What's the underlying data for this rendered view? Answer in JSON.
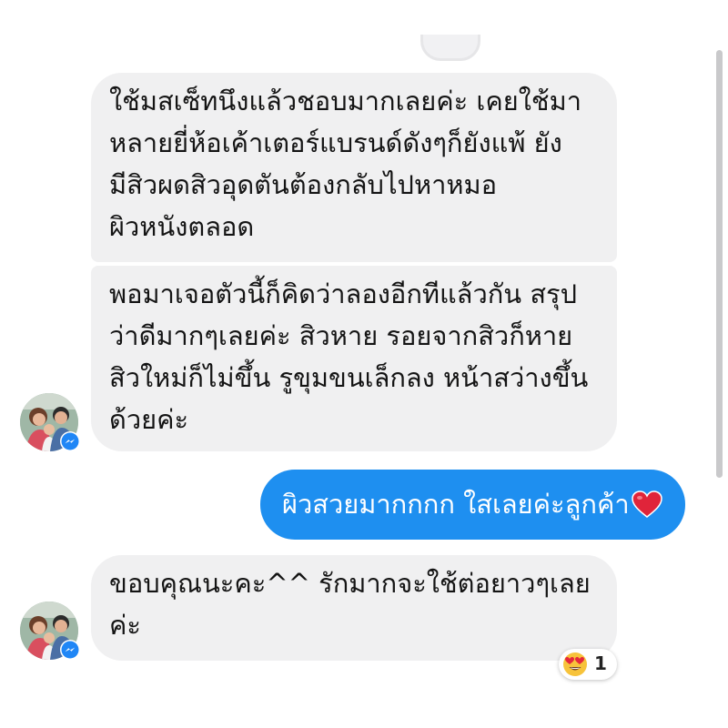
{
  "messages": {
    "incoming_1": "ใช้มสเซ็ทนึงแล้วชอบมากเลยค่ะ เคยใช้มา\nหลายยี่ห้อเค้าเตอร์แบรนด์ดังๆก็ยังแพ้ ยัง\nมีสิวผดสิวอุดตันต้องกลับไปหาหมอ\nผิวหนังตลอด",
    "incoming_2": "พอมาเจอตัวนี้ก็คิดว่าลองอีกทีแล้วกัน สรุป\nว่าดีมากๆเลยค่ะ สิวหาย รอยจากสิวก็หาย\nสิวใหม่ก็ไม่ขึ้น รูขุมขนเล็กลง หน้าสว่างขึ้น\nด้วยค่ะ",
    "outgoing_1": "ผิวสวยมากกกก ใสเลยค่ะลูกค้า",
    "incoming_3": "ขอบคุณนะคะ^^ รักมากจะใช้ต่อยาวๆเลย\nค่ะ"
  },
  "reaction": {
    "emoji": "heart-eyes-emoji",
    "count": "1"
  },
  "icons": {
    "outgoing_emoji": "red-heart-icon",
    "badge": "messenger-icon"
  },
  "colors": {
    "incoming_bubble": "#f0f0f1",
    "outgoing_bubble": "#1e8ff0",
    "messenger_badge": "#1f86f6",
    "heart": "#e0243a"
  }
}
